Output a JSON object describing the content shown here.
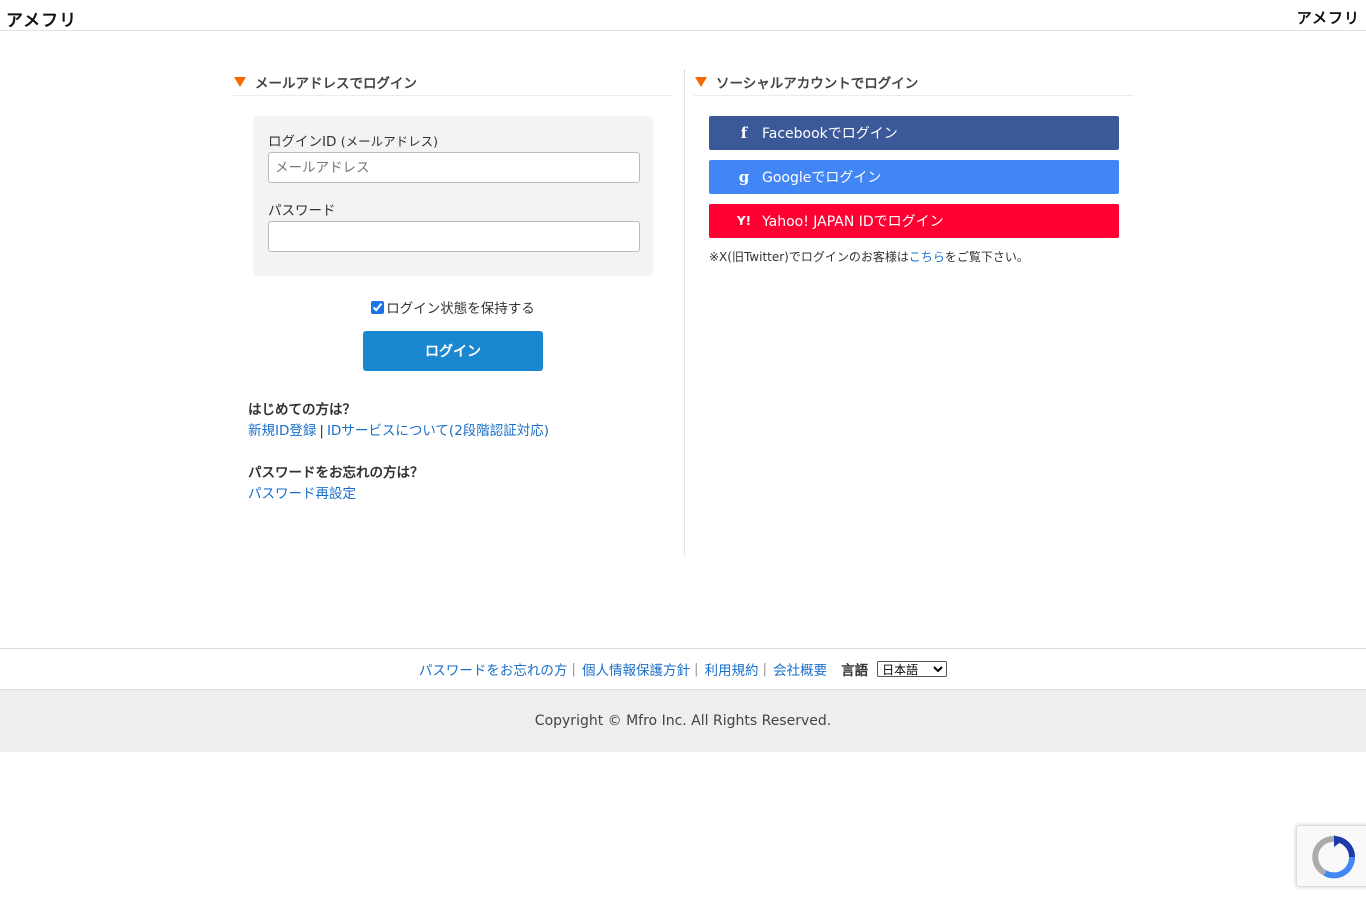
{
  "header": {
    "logo_left": "アメフリ",
    "logo_right": "アメフリ"
  },
  "email_login": {
    "title": "メールアドレスでログイン",
    "login_id_label": "ログインID",
    "login_id_sub": "(メールアドレス)",
    "login_id_placeholder": "メールアドレス",
    "login_id_value": "",
    "password_label": "パスワード",
    "password_value": "",
    "keep_login_label": "ログイン状態を保持する",
    "keep_login_checked": true,
    "login_button": "ログイン"
  },
  "help": {
    "new_question": "はじめての方は？",
    "register_link": "新規ID登録",
    "separator": "|",
    "id_service_link": "IDサービスについて(2段階認証対応)",
    "forgot_question": "パスワードをお忘れの方は？",
    "reset_link": "パスワード再設定"
  },
  "social_login": {
    "title": "ソーシャルアカウントでログイン",
    "facebook": "Facebookでログイン",
    "google": "Googleでログイン",
    "yahoo": "Yahoo! JAPAN IDでログイン",
    "twitter_note_pre": "※X(旧Twitter)でログインのお客様は",
    "twitter_note_link": "こちら",
    "twitter_note_post": "をご覧下さい。",
    "colors": {
      "facebook": "#3b5998",
      "google": "#4285f4",
      "yahoo": "#ff0033"
    }
  },
  "footer": {
    "links": [
      "パスワードをお忘れの方",
      "個人情報保護方針",
      "利用規約",
      "会社概要"
    ],
    "lang_label": "言語",
    "lang_selected": "日本語",
    "copyright": "Copyright © Mfro Inc. All Rights Reserved."
  },
  "accent": {
    "triangle": "#f56a00",
    "login_button": "#1a87d0",
    "link": "#1a6fc9"
  }
}
